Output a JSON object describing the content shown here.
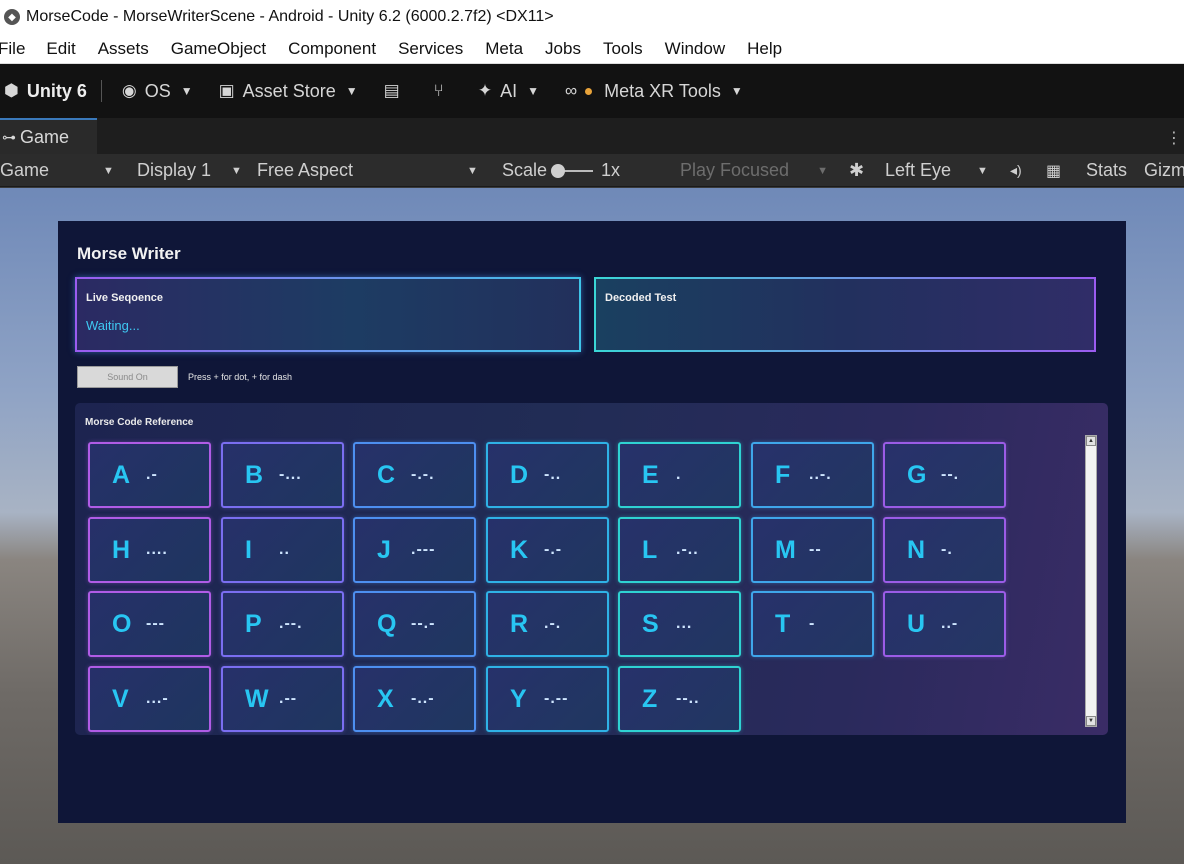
{
  "window": {
    "title": "MorseCode - MorseWriterScene - Android - Unity 6.2 (6000.2.7f2) <DX11>"
  },
  "menu": [
    "File",
    "Edit",
    "Assets",
    "GameObject",
    "Component",
    "Services",
    "Meta",
    "Jobs",
    "Tools",
    "Window",
    "Help"
  ],
  "toolbar": {
    "unity_label": "Unity 6",
    "os_label": "OS",
    "asset_store_label": "Asset Store",
    "ai_label": "AI",
    "meta_xr_label": "Meta XR Tools"
  },
  "game_tab": {
    "label": "Game"
  },
  "game_controls": {
    "view_mode": "Game",
    "display": "Display 1",
    "aspect": "Free Aspect",
    "scale_label": "Scale",
    "scale_value": "1x",
    "play_mode": "Play Focused",
    "eye": "Left Eye",
    "stats": "Stats",
    "gizmos": "Gizm"
  },
  "morse": {
    "title": "Morse Writer",
    "live_label": "Live Seqoence",
    "live_value": "Waiting...",
    "decoded_label": "Decoded Test",
    "decoded_value": "",
    "sound_button": "Sound On",
    "hint": "Press + for dot, + for dash",
    "reference_title": "Morse Code Reference",
    "letters": [
      {
        "letter": "A",
        "code": ".-"
      },
      {
        "letter": "B",
        "code": "-..."
      },
      {
        "letter": "C",
        "code": "-.-."
      },
      {
        "letter": "D",
        "code": "-.."
      },
      {
        "letter": "E",
        "code": "."
      },
      {
        "letter": "F",
        "code": "..-."
      },
      {
        "letter": "G",
        "code": "--."
      },
      {
        "letter": "H",
        "code": "...."
      },
      {
        "letter": "I",
        "code": ".."
      },
      {
        "letter": "J",
        "code": ".---"
      },
      {
        "letter": "K",
        "code": "-.-"
      },
      {
        "letter": "L",
        "code": ".-.."
      },
      {
        "letter": "M",
        "code": "--"
      },
      {
        "letter": "N",
        "code": "-."
      },
      {
        "letter": "O",
        "code": "---"
      },
      {
        "letter": "P",
        "code": ".--."
      },
      {
        "letter": "Q",
        "code": "--.-"
      },
      {
        "letter": "R",
        "code": ".-."
      },
      {
        "letter": "S",
        "code": "..."
      },
      {
        "letter": "T",
        "code": "-"
      },
      {
        "letter": "U",
        "code": "..-"
      },
      {
        "letter": "V",
        "code": "...-"
      },
      {
        "letter": "W",
        "code": ".--"
      },
      {
        "letter": "X",
        "code": "-..-"
      },
      {
        "letter": "Y",
        "code": "-.--"
      },
      {
        "letter": "Z",
        "code": "--.."
      }
    ],
    "column_colors": [
      "#b05ce6",
      "#7a6ef0",
      "#4d8ff0",
      "#2fb2e6",
      "#2fd2d2",
      "#3fa6ea",
      "#9b5ce6"
    ]
  }
}
